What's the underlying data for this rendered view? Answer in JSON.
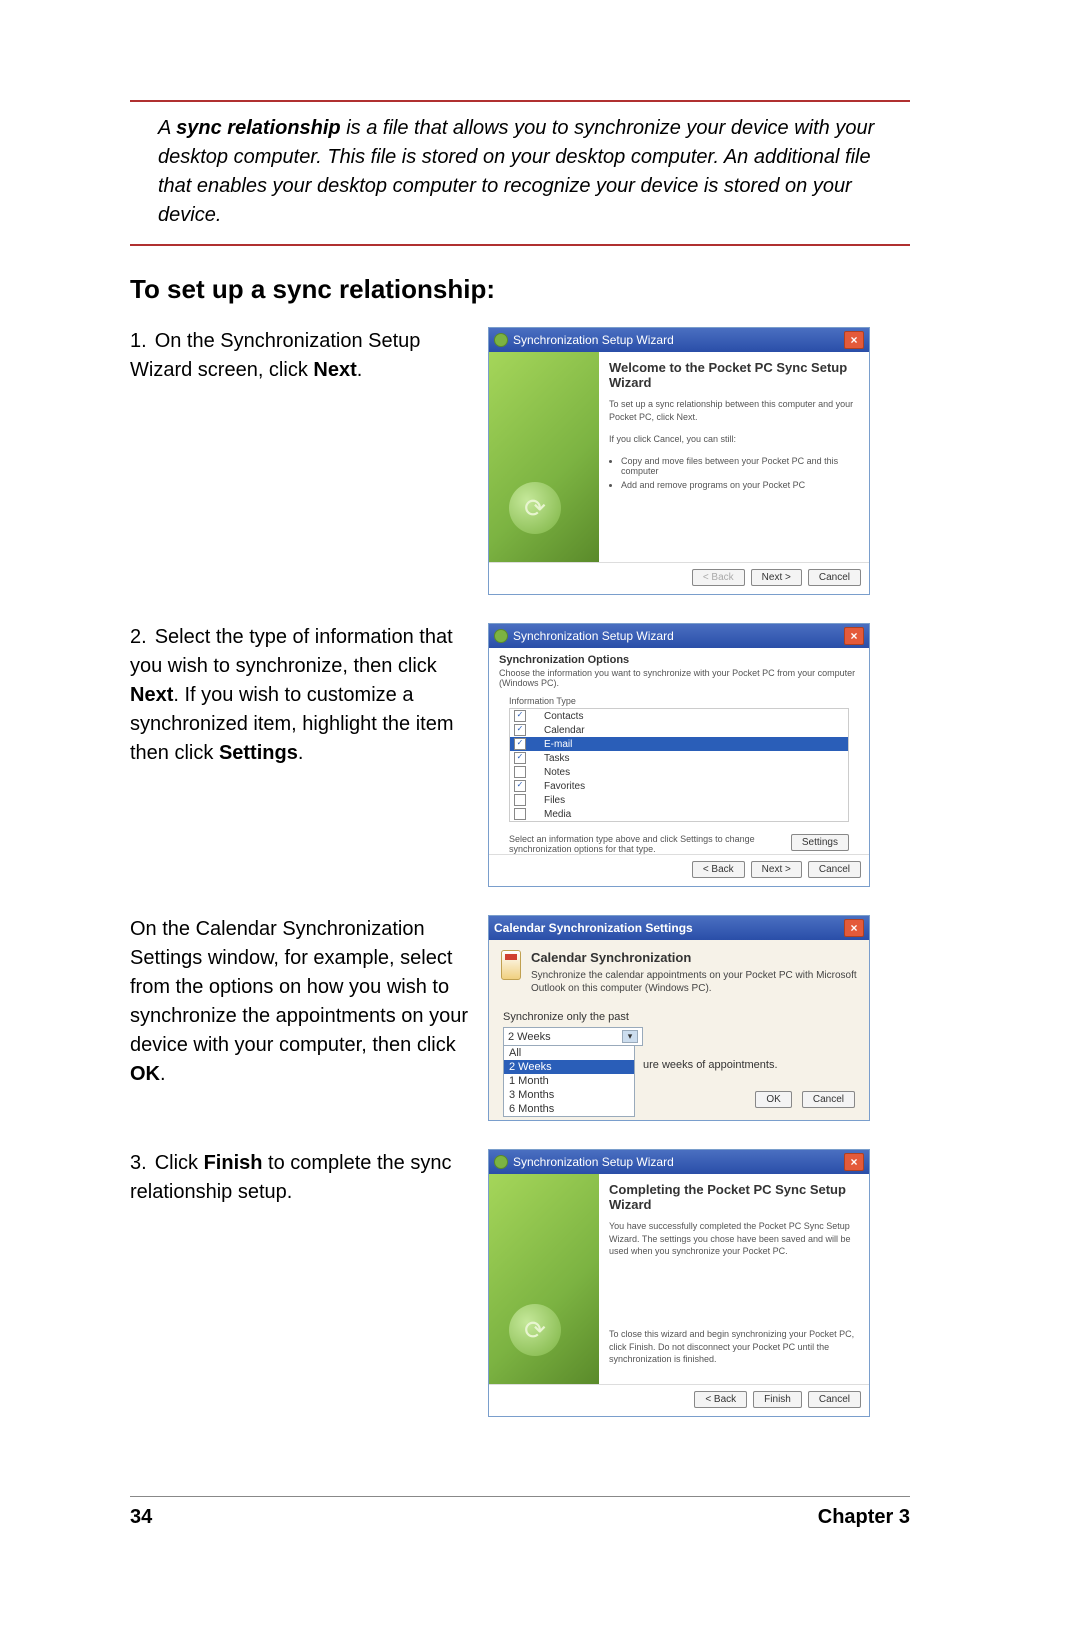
{
  "note": {
    "prefix_a": "A ",
    "bold_term": "sync relationship",
    "rest": " is a file that allows you to synchronize your device with your desktop computer. This file is stored on your desktop computer. An additional file that enables your desktop computer to recognize your device is stored on your device."
  },
  "heading": "To set up a sync relationship:",
  "steps": {
    "s1": {
      "num": "1.",
      "pre": "On the Synchronization Setup Wizard screen, click ",
      "bold": "Next",
      "post": "."
    },
    "s2": {
      "num": "2.",
      "t1": "Select the type of information that you wish to synchronize, then click ",
      "b1": "Next",
      "t2": ". If you wish to customize a synchronized item, highlight the item then click ",
      "b2": "Settings",
      "t3": "."
    },
    "s2b": {
      "t1": "On the Calendar Synchronization Settings window, for example, select from the options on how you wish to synchronize the appointments on your device with your computer, then click ",
      "b1": "OK",
      "t2": "."
    },
    "s3": {
      "num": "3.",
      "t1": "Click ",
      "b1": "Finish",
      "t2": " to complete the sync relationship setup."
    }
  },
  "wizard1": {
    "title": "Synchronization Setup Wizard",
    "heading": "Welcome to the Pocket PC Sync Setup Wizard",
    "p1": "To set up a sync relationship between this computer and your Pocket PC, click Next.",
    "p2": "If you click Cancel, you can still:",
    "li1": "Copy and move files between your Pocket PC and this computer",
    "li2": "Add and remove programs on your Pocket PC",
    "btn_back": "< Back",
    "btn_next": "Next >",
    "btn_cancel": "Cancel"
  },
  "wizard2": {
    "title": "Synchronization Setup Wizard",
    "opt_title": "Synchronization Options",
    "opt_sub": "Choose the information you want to synchronize with your Pocket PC from your computer (Windows PC).",
    "list_label": "Information Type",
    "items": [
      {
        "label": "Contacts",
        "checked": true,
        "sel": false
      },
      {
        "label": "Calendar",
        "checked": true,
        "sel": false
      },
      {
        "label": "E-mail",
        "checked": true,
        "sel": true
      },
      {
        "label": "Tasks",
        "checked": true,
        "sel": false
      },
      {
        "label": "Notes",
        "checked": false,
        "sel": false
      },
      {
        "label": "Favorites",
        "checked": true,
        "sel": false
      },
      {
        "label": "Files",
        "checked": false,
        "sel": false
      },
      {
        "label": "Media",
        "checked": false,
        "sel": false
      }
    ],
    "below_text": "Select an information type above and click Settings to change synchronization options for that type.",
    "btn_settings": "Settings",
    "btn_back": "< Back",
    "btn_next": "Next >",
    "btn_cancel": "Cancel"
  },
  "calwin": {
    "title": "Calendar Synchronization Settings",
    "sect_title": "Calendar Synchronization",
    "sect_desc": "Synchronize the calendar appointments on your Pocket PC with Microsoft Outlook on this computer (Windows PC).",
    "past_label": "Synchronize only the past",
    "combo_value": "2 Weeks",
    "options": [
      "All",
      "2 Weeks",
      "1 Month",
      "3 Months",
      "6 Months"
    ],
    "future_suffix": "ure weeks of appointments.",
    "btn_ok": "OK",
    "btn_cancel": "Cancel"
  },
  "wizard3": {
    "title": "Synchronization Setup Wizard",
    "heading": "Completing the Pocket PC Sync Setup Wizard",
    "p1": "You have successfully completed the Pocket PC Sync Setup Wizard. The settings you chose have been saved and will be used when you synchronize your Pocket PC.",
    "p2": "To close this wizard and begin synchronizing your Pocket PC, click Finish. Do not disconnect your Pocket PC until the synchronization is finished.",
    "btn_back": "< Back",
    "btn_finish": "Finish",
    "btn_cancel": "Cancel"
  },
  "footer": {
    "page": "34",
    "chapter": "Chapter 3"
  }
}
